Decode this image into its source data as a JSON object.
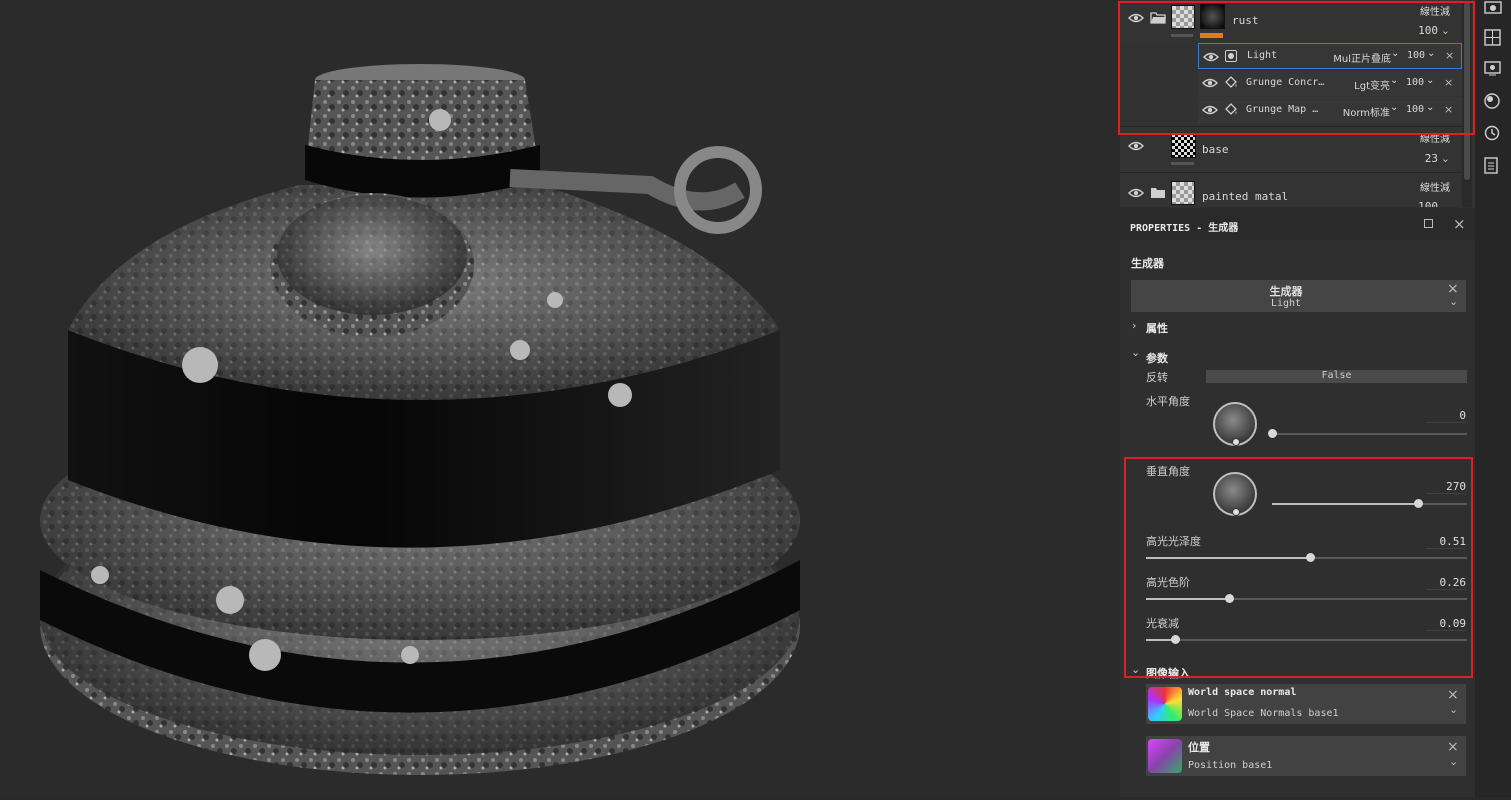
{
  "layers": {
    "rust": {
      "name": "rust",
      "blend": "線性減",
      "opacity": "100",
      "effects": [
        {
          "name": "Light",
          "blend": "Mul正片叠底",
          "opacity": "100",
          "icon": "filter-icon"
        },
        {
          "name": "Grunge Concr…",
          "blend": "Lgt变亮",
          "opacity": "100",
          "icon": "fill-icon"
        },
        {
          "name": "Grunge Map …",
          "blend": "Norm标准",
          "opacity": "100",
          "icon": "fill-icon"
        }
      ]
    },
    "base": {
      "name": "base",
      "blend": "線性減",
      "opacity": "23"
    },
    "painted": {
      "name": "painted matal",
      "blend": "線性減",
      "opacity": "100"
    }
  },
  "properties": {
    "title": "PROPERTIES - 生成器",
    "section": "生成器",
    "generator_name": "生成器",
    "generator_value": "Light",
    "group_attributes": "属性",
    "group_params": "参数",
    "invert_label": "反转",
    "invert_value": "False",
    "horizontal_angle_label": "水平角度",
    "horizontal_angle": "0",
    "horizontal_angle_fraction": 0.0,
    "vertical_angle_label": "垂直角度",
    "vertical_angle": "270",
    "vertical_angle_fraction": 0.75,
    "gloss_label": "高光光泽度",
    "gloss": "0.51",
    "gloss_fraction": 0.51,
    "levels_label": "高光色阶",
    "levels": "0.26",
    "levels_fraction": 0.26,
    "falloff_label": "光衰减",
    "falloff": "0.09",
    "falloff_fraction": 0.09,
    "group_image_input": "图像输入",
    "inputs": [
      {
        "title": "World space normal",
        "value": "World Space Normals base1"
      },
      {
        "title": "位置",
        "value": "Position base1"
      }
    ]
  },
  "colors": {
    "highlight": "#e02020",
    "accent": "#e07b20",
    "selection": "#3a7bd5"
  }
}
